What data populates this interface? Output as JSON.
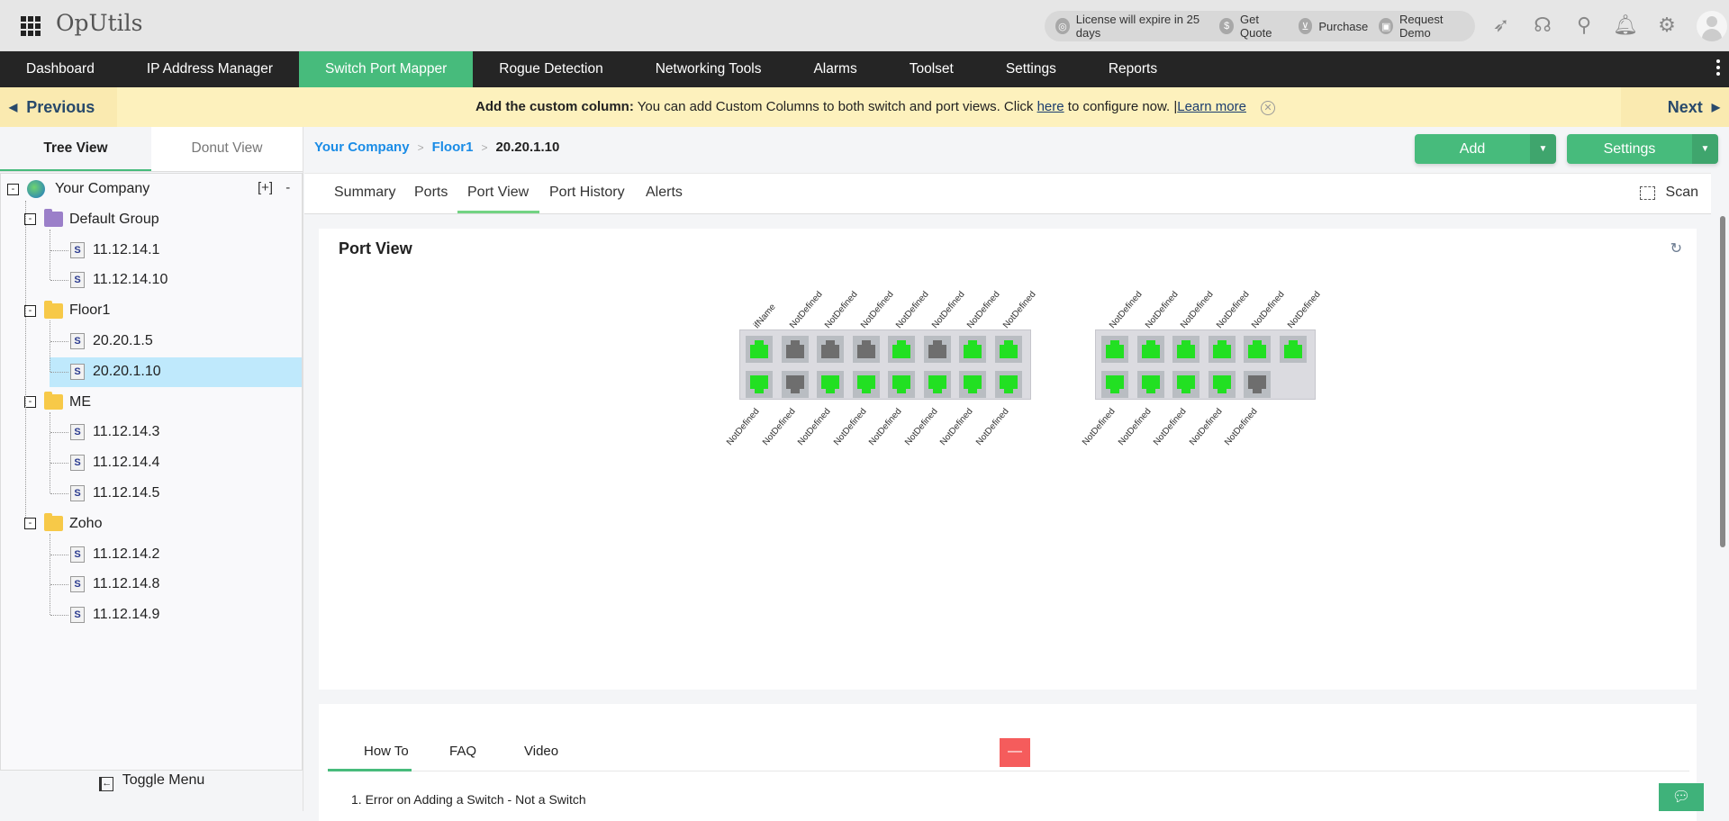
{
  "app": {
    "title": "OpUtils"
  },
  "topbar": {
    "pill_items": [
      {
        "icon": "license-icon",
        "label": "License will expire in 25 days"
      },
      {
        "icon": "dollar-icon",
        "label": "Get Quote"
      },
      {
        "icon": "cart-icon",
        "label": "Purchase"
      },
      {
        "icon": "video-icon",
        "label": "Request Demo"
      }
    ],
    "icons": [
      "rocket-icon",
      "headset-icon",
      "search-icon",
      "bell-icon",
      "gear-icon",
      "avatar"
    ]
  },
  "nav": {
    "items": [
      "Dashboard",
      "IP Address Manager",
      "Switch Port Mapper",
      "Rogue Detection",
      "Networking Tools",
      "Alarms",
      "Toolset",
      "Settings",
      "Reports"
    ],
    "active": "Switch Port Mapper"
  },
  "banner": {
    "prev_label": "Previous",
    "next_label": "Next",
    "title": "Add the custom column:",
    "text": " You can add Custom Columns to both switch and port views. Click ",
    "link1": "here",
    "text2": " to configure now. |",
    "link2": "Learn more"
  },
  "sidebar": {
    "tabs": [
      "Tree View",
      "Donut View"
    ],
    "active_tab": "Tree View",
    "tree_controls": {
      "expand": "[+]",
      "collapse": "-"
    },
    "root": "Your Company",
    "groups": [
      {
        "name": "Default Group",
        "color": "#9b7fc9",
        "children": [
          "11.12.14.1",
          "11.12.14.10"
        ]
      },
      {
        "name": "Floor1",
        "color": "#f7c948",
        "children": [
          "20.20.1.5",
          "20.20.1.10"
        ]
      },
      {
        "name": "ME",
        "color": "#f7c948",
        "children": [
          "11.12.14.3",
          "11.12.14.4",
          "11.12.14.5"
        ]
      },
      {
        "name": "Zoho",
        "color": "#f7c948",
        "children": [
          "11.12.14.2",
          "11.12.14.8",
          "11.12.14.9"
        ]
      }
    ],
    "selected": "20.20.1.10",
    "toggle_menu": "Toggle Menu"
  },
  "breadcrumb": {
    "items": [
      "Your Company",
      "Floor1"
    ],
    "current": "20.20.1.10"
  },
  "actions": {
    "add_label": "Add",
    "settings_label": "Settings"
  },
  "subtabs": {
    "items": [
      "Summary",
      "Ports",
      "Port View",
      "Port History",
      "Alerts"
    ],
    "active": "Port View",
    "scan_label": "Scan"
  },
  "port_view": {
    "title": "Port View",
    "colors": {
      "up": "#22e022",
      "down": "#6e6e6e"
    },
    "switches": [
      {
        "top_labels": [
          "ifName",
          "NotDefined",
          "NotDefined",
          "NotDefined",
          "NotDefined",
          "NotDefined",
          "NotDefined",
          "NotDefined"
        ],
        "top_status": [
          "up",
          "down",
          "down",
          "down",
          "up",
          "down",
          "up",
          "up"
        ],
        "bottom_labels": [
          "NotDefined",
          "NotDefined",
          "NotDefined",
          "NotDefined",
          "NotDefined",
          "NotDefined",
          "NotDefined",
          "NotDefined"
        ],
        "bottom_status": [
          "up",
          "down",
          "up",
          "up",
          "up",
          "up",
          "up",
          "up"
        ]
      },
      {
        "top_labels": [
          "NotDefined",
          "NotDefined",
          "NotDefined",
          "NotDefined",
          "NotDefined",
          "NotDefined"
        ],
        "top_status": [
          "up",
          "up",
          "up",
          "up",
          "up",
          "up"
        ],
        "bottom_labels": [
          "NotDefined",
          "NotDefined",
          "NotDefined",
          "NotDefined",
          "NotDefined"
        ],
        "bottom_status": [
          "up",
          "up",
          "up",
          "up",
          "down"
        ]
      }
    ]
  },
  "help": {
    "tabs": [
      "How To",
      "FAQ",
      "Video"
    ],
    "active": "How To",
    "items": [
      "1. Error on Adding a Switch - Not a Switch"
    ],
    "minimize_label": "—"
  }
}
